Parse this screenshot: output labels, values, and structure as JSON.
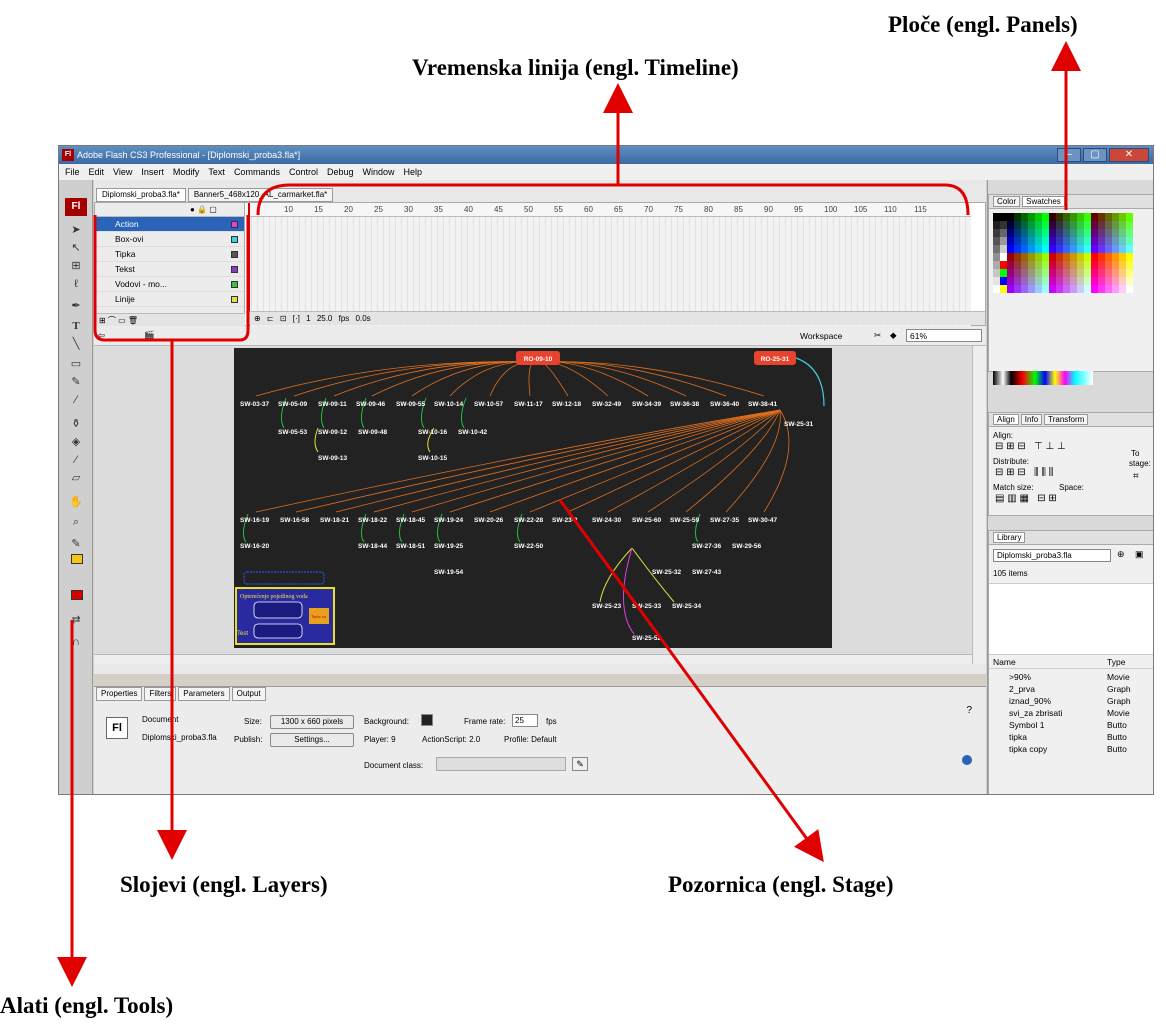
{
  "annotations": {
    "panels": "Ploče  (engl. Panels)",
    "timeline": "Vremenska linija  (engl. Timeline)",
    "layers": "Slojevi  (engl. Layers)",
    "stage": "Pozornica  (engl. Stage)",
    "tools": "Alati (engl. Tools)"
  },
  "window": {
    "title": "Adobe Flash CS3 Professional - [Diplomski_proba3.fla*]",
    "min": "–",
    "max": "▢",
    "close": "✕"
  },
  "menu": [
    "File",
    "Edit",
    "View",
    "Insert",
    "Modify",
    "Text",
    "Commands",
    "Control",
    "Debug",
    "Window",
    "Help"
  ],
  "doc_tabs": [
    "Diplomski_proba3.fla*",
    "Banner5_468x120_AL_carmarket.fla*"
  ],
  "timeline": {
    "ruler": [
      "10",
      "15",
      "20",
      "25",
      "30",
      "35",
      "40",
      "45",
      "50",
      "55",
      "60",
      "65",
      "70",
      "75",
      "80",
      "85",
      "90",
      "95",
      "100",
      "105",
      "110",
      "115"
    ],
    "layers": [
      {
        "name": "Action",
        "color": "#e040e0"
      },
      {
        "name": "Box-ovi",
        "color": "#40d0e0"
      },
      {
        "name": "Tipka",
        "color": "#555555"
      },
      {
        "name": "Tekst",
        "color": "#8040c0"
      },
      {
        "name": "Vodovi - mo...",
        "color": "#40c040"
      },
      {
        "name": "Linije",
        "color": "#e0e040"
      }
    ],
    "frame": "1",
    "fps": "25.0 fps",
    "time": "0.0s"
  },
  "editbar": {
    "workspace": "Workspace",
    "zoom": "61%"
  },
  "stage": {
    "ro1": "RO-09-10",
    "ro2": "RO-25-31",
    "row1": [
      "SW-03-37",
      "SW-05-09",
      "SW-09-11",
      "SW-09-46",
      "SW-09-55",
      "SW-10-14",
      "SW-10-57",
      "SW-11-17",
      "SW-12-18",
      "SW-32-49",
      "SW-34-39",
      "SW-36-38",
      "SW-36-40",
      "SW-38-41"
    ],
    "row1b": [
      "SW-05-53",
      "SW-09-12",
      "SW-09-48",
      "SW-10-16",
      "SW-10-42"
    ],
    "row1c": [
      "SW-09-13",
      "SW-10-15"
    ],
    "sw2531": "SW-25-31",
    "row2": [
      "SW-16-19",
      "SW-16-58",
      "SW-18-21",
      "SW-18-22",
      "SW-18-45",
      "SW-19-24",
      "SW-20-26",
      "SW-22-28",
      "SW-23-2",
      "SW-24-30",
      "SW-25-60",
      "SW-25-59",
      "SW-27-35",
      "SW-30-47"
    ],
    "row2b": [
      "SW-16-20",
      "SW-18-44",
      "SW-18-51",
      "SW-19-25",
      "SW-22-50",
      "SW-27-36",
      "SW-29-56"
    ],
    "row2c": [
      "SW-19-54",
      "SW-25-32",
      "SW-27-43"
    ],
    "row3": [
      "SW-25-23",
      "SW-25-33",
      "SW-25-34"
    ],
    "row4": "SW-25-52",
    "box_title": "Opterećenje pojedinog voda",
    "box_test": "Test",
    "box_btn": "Tipka za"
  },
  "props": {
    "tabs": [
      "Properties",
      "Filters",
      "Parameters",
      "Output"
    ],
    "doc_label": "Document",
    "doc_name": "Diplomski_proba3.fla",
    "size_label": "Size:",
    "size_value": "1300 x 660 pixels",
    "bg_label": "Background:",
    "fr_label": "Frame rate:",
    "fr_value": "25",
    "fps": "fps",
    "publish_label": "Publish:",
    "settings": "Settings...",
    "player": "Player:  9",
    "as": "ActionScript:  2.0",
    "profile": "Profile:  Default",
    "docclass": "Document class:"
  },
  "panels": {
    "color_tabs": [
      "Color",
      "Swatches"
    ],
    "align_tabs": [
      "Align",
      "Info",
      "Transform"
    ],
    "align": "Align:",
    "distribute": "Distribute:",
    "match": "Match size:",
    "space": "Space:",
    "to": "To",
    "stage": "stage:",
    "library_tab": "Library",
    "library_doc": "Diplomski_proba3.fla",
    "items_count": "105 items",
    "col_name": "Name",
    "col_type": "Type",
    "items": [
      {
        "name": ">90%",
        "type": "Movie"
      },
      {
        "name": "2_prva",
        "type": "Graph"
      },
      {
        "name": "iznad_90%",
        "type": "Graph"
      },
      {
        "name": "svi_za zbrisati",
        "type": "Movie"
      },
      {
        "name": "Symbol 1",
        "type": "Butto"
      },
      {
        "name": "tipka",
        "type": "Butto"
      },
      {
        "name": "tipka copy",
        "type": "Butto"
      }
    ]
  }
}
